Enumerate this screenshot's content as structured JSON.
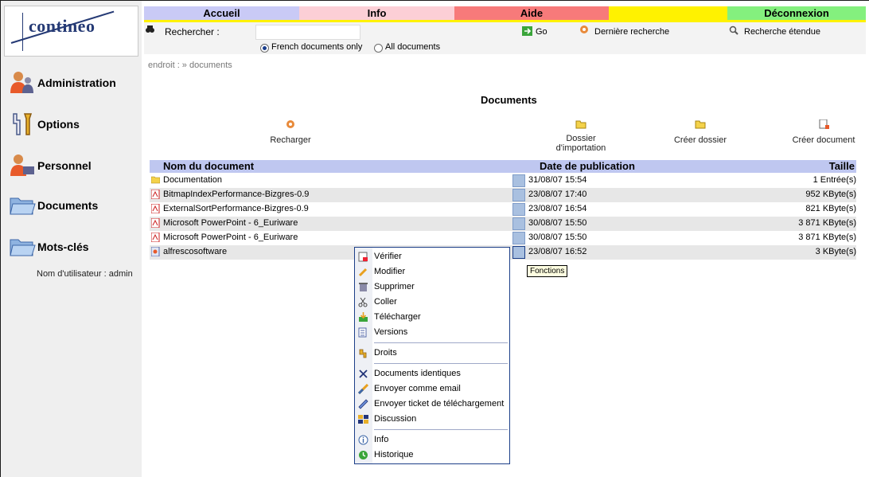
{
  "app": {
    "logo": "contineo"
  },
  "nav": {
    "accueil": "Accueil",
    "info": "Info",
    "aide": "Aide",
    "deconnexion": "Déconnexion"
  },
  "search": {
    "label": "Rechercher :",
    "placeholder": "",
    "scope_french": "French documents only",
    "scope_all": "All documents",
    "selected_scope": "French documents only",
    "go": "Go",
    "last_search": "Dernière recherche",
    "advanced": "Recherche étendue"
  },
  "sidebar": {
    "items": [
      {
        "label": "Administration",
        "icon": "admin-users-icon"
      },
      {
        "label": "Options",
        "icon": "wrench-options-icon"
      },
      {
        "label": "Personnel",
        "icon": "personal-user-icon"
      },
      {
        "label": "Documents",
        "icon": "folder-open-icon"
      },
      {
        "label": "Mots-clés",
        "icon": "folder-keywords-icon"
      }
    ],
    "user": "Nom d'utilisateur : admin"
  },
  "breadcrumb": "endroit : » documents",
  "page_title": "Documents",
  "actions": {
    "reload": "Recharger",
    "import_line1": "Dossier",
    "import_line2": "d'importation",
    "create_folder": "Créer dossier",
    "create_document": "Créer document"
  },
  "table": {
    "columns": [
      "Nom du document",
      "Date de publication",
      "Taille"
    ],
    "rows": [
      {
        "name": "Documentation",
        "date": "31/08/07 15:54",
        "size": "1  Entrée(s)",
        "type": "folder"
      },
      {
        "name": "BitmapIndexPerformance-Bizgres-0.9",
        "date": "23/08/07 17:40",
        "size": "952  KByte(s)",
        "type": "pdf"
      },
      {
        "name": "ExternalSortPerformance-Bizgres-0.9",
        "date": "23/08/07 16:54",
        "size": "821  KByte(s)",
        "type": "pdf"
      },
      {
        "name": "Microsoft PowerPoint - 6_Euriware",
        "date": "30/08/07 15:50",
        "size": "3 871  KByte(s)",
        "type": "pdf"
      },
      {
        "name": "Microsoft PowerPoint - 6_Euriware",
        "date": "30/08/07 15:50",
        "size": "3 871  KByte(s)",
        "type": "pdf"
      },
      {
        "name": "alfrescosoftware",
        "date": "23/08/07 16:52",
        "size": "3  KByte(s)",
        "type": "file"
      }
    ]
  },
  "tooltip": "Fonctions",
  "context_menu": {
    "items": [
      "Vérifier",
      "Modifier",
      "Supprimer",
      "Coller",
      "Télécharger",
      "Versions",
      "Droits",
      "Documents identiques",
      "Envoyer comme email",
      "Envoyer ticket de téléchargement",
      "Discussion",
      "Info",
      "Historique"
    ]
  },
  "colors": {
    "tab_accueil": "#c9caf6",
    "tab_info": "#fccfd6",
    "tab_aide": "#f77a7a",
    "tab_yellow": "#fff200",
    "tab_deconnexion": "#84f07e",
    "table_header": "#bfc7f0",
    "menu_border": "#1c3f88"
  }
}
